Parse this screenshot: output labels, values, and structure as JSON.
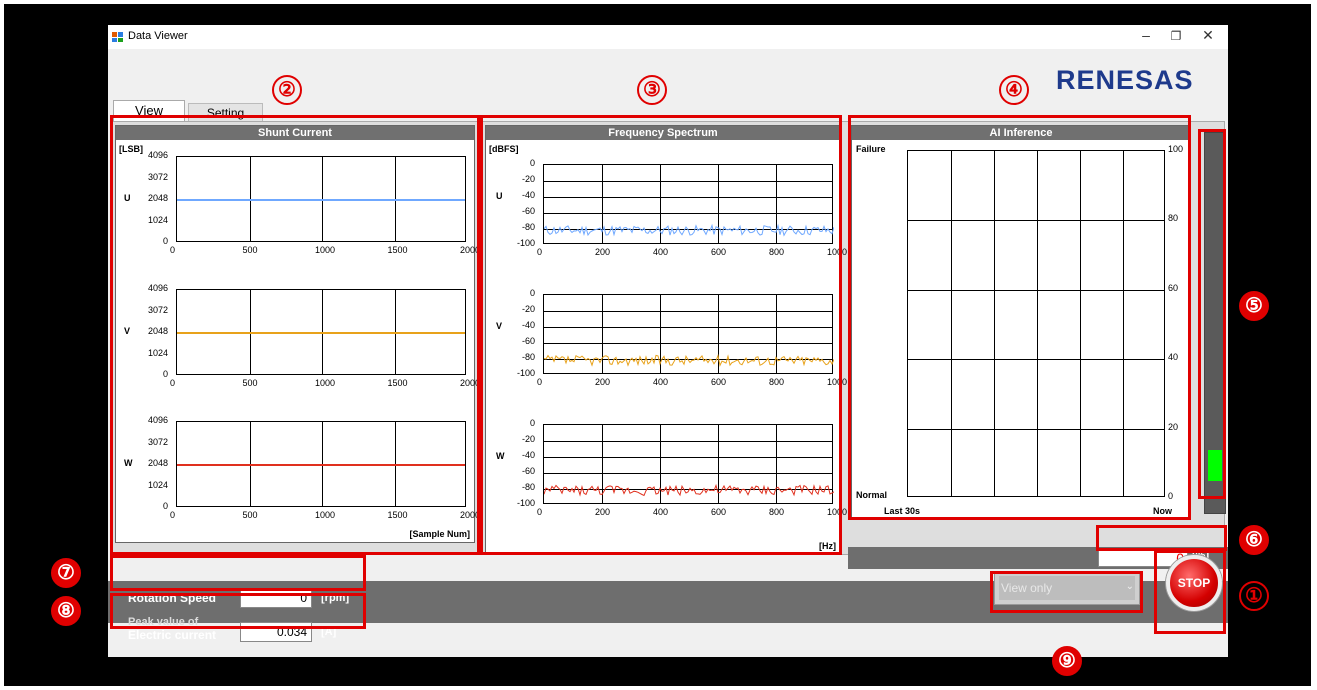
{
  "window": {
    "title": "Data Viewer",
    "logo": "RENESAS"
  },
  "tabs": [
    {
      "label": "View"
    },
    {
      "label": "Setting"
    }
  ],
  "shunt": {
    "title": "Shunt Current",
    "unit": "[LSB]",
    "xlabel": "[Sample Num]",
    "y_ticks": [
      "4096",
      "3072",
      "2048",
      "1024",
      "0"
    ],
    "x_ticks": [
      "0",
      "500",
      "1000",
      "1500",
      "2000"
    ],
    "phases": [
      "U",
      "V",
      "W"
    ]
  },
  "spectrum": {
    "title": "Frequency Spectrum",
    "unit": "[dBFS]",
    "xlabel": "[Hz]",
    "y_ticks": [
      "0",
      "-20",
      "-40",
      "-60",
      "-80",
      "-100"
    ],
    "x_ticks": [
      "0",
      "200",
      "400",
      "600",
      "800",
      "1000"
    ],
    "phases": [
      "U",
      "V",
      "W"
    ]
  },
  "ai": {
    "title": "AI Inference",
    "top_label": "Failure",
    "bottom_label": "Normal",
    "x_left": "Last 30s",
    "x_right": "Now",
    "y_ticks": [
      "100",
      "80",
      "60",
      "40",
      "20",
      "0"
    ]
  },
  "colors": {
    "U": "#6fa8ff",
    "V": "#e8a21a",
    "W": "#e0301e",
    "bar": "#00ff00",
    "callout": "#e00000"
  },
  "gauge": {
    "level_percent": 8
  },
  "percent": {
    "value": "0",
    "unit": "[%]"
  },
  "rotation": {
    "label": "Rotation Speed",
    "value": "0",
    "unit": "[rpm]"
  },
  "peak": {
    "label_line1": "Peak value of",
    "label_line2": "Electric current",
    "value": "0.034",
    "unit": "[A]"
  },
  "mode": {
    "selected": "View only"
  },
  "stop": {
    "label": "STOP"
  },
  "callouts": [
    "①",
    "②",
    "③",
    "④",
    "⑤",
    "⑥",
    "⑦",
    "⑧",
    "⑨"
  ]
}
